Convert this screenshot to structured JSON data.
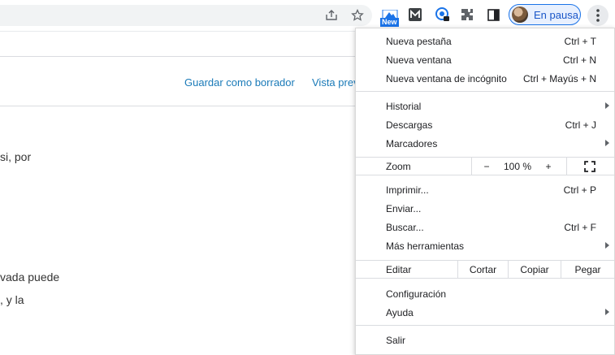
{
  "toolbar": {
    "new_badge": "New",
    "profile_label": "En pausa"
  },
  "page": {
    "save_draft": "Guardar como borrador",
    "preview": "Vista previa",
    "text1": "si, por",
    "text2": "vada puede",
    "text3": ", y la"
  },
  "menu": {
    "new_tab": {
      "label": "Nueva pestaña",
      "shortcut": "Ctrl + T"
    },
    "new_window": {
      "label": "Nueva ventana",
      "shortcut": "Ctrl + N"
    },
    "incognito": {
      "label": "Nueva ventana de incógnito",
      "shortcut": "Ctrl + Mayús + N"
    },
    "history": {
      "label": "Historial"
    },
    "downloads": {
      "label": "Descargas",
      "shortcut": "Ctrl + J"
    },
    "bookmarks": {
      "label": "Marcadores"
    },
    "zoom": {
      "label": "Zoom",
      "minus": "−",
      "value": "100 %",
      "plus": "+"
    },
    "print": {
      "label": "Imprimir...",
      "shortcut": "Ctrl + P"
    },
    "cast": {
      "label": "Enviar..."
    },
    "find": {
      "label": "Buscar...",
      "shortcut": "Ctrl + F"
    },
    "more_tools": {
      "label": "Más herramientas"
    },
    "edit": {
      "label": "Editar",
      "cut": "Cortar",
      "copy": "Copiar",
      "paste": "Pegar"
    },
    "settings": {
      "label": "Configuración"
    },
    "help": {
      "label": "Ayuda"
    },
    "exit": {
      "label": "Salir"
    }
  }
}
